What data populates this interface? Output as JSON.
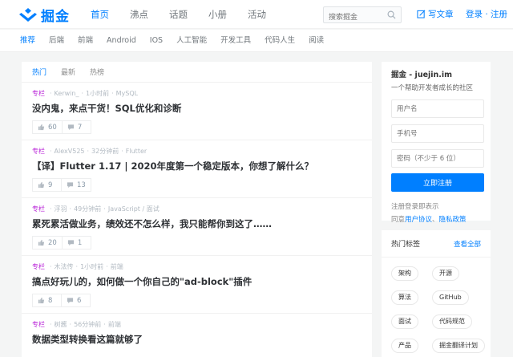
{
  "brand": {
    "name": "掘金",
    "color": "#007fff"
  },
  "nav": [
    "首页",
    "沸点",
    "话题",
    "小册",
    "活动"
  ],
  "search": {
    "placeholder": "搜索掘金"
  },
  "write_label": "写文章",
  "login_label": "登录 · 注册",
  "subnav": [
    "推荐",
    "后端",
    "前端",
    "Android",
    "IOS",
    "人工智能",
    "开发工具",
    "代码人生",
    "阅读"
  ],
  "feed_tabs": [
    "热门",
    "最新",
    "热榜"
  ],
  "entries": [
    {
      "tag": "专栏",
      "author": "Kerwin_",
      "time": "1小时前",
      "category": "MySQL",
      "title": "没内鬼，来点干货！SQL优化和诊断",
      "likes": "60",
      "comments": "7"
    },
    {
      "tag": "专栏",
      "author": "AlexV525",
      "time": "32分钟前",
      "category": "Flutter",
      "title": "【译】Flutter 1.17 | 2020年度第一个稳定版本，你想了解什么？",
      "likes": "9",
      "comments": "13"
    },
    {
      "tag": "专栏",
      "author": "浮羽",
      "time": "49分钟前",
      "category": "JavaScript / 面试",
      "title": "累死累活做业务，绩效还不怎么样，我只能帮你到这了……",
      "likes": "20",
      "comments": "1"
    },
    {
      "tag": "专栏",
      "author": "木法传",
      "time": "1小时前",
      "category": "前端",
      "title": "搞点好玩儿的，如何做一个你自己的\"ad-block\"插件",
      "likes": "8",
      "comments": "6"
    },
    {
      "tag": "专栏",
      "author": "树酱",
      "time": "56分钟前",
      "category": "前端",
      "title": "数据类型转换看这篇就够了",
      "likes": "",
      "comments": ""
    }
  ],
  "register": {
    "title": "掘金 - juejin.im",
    "subtitle": "一个帮助开发者成长的社区",
    "username_placeholder": "用户名",
    "phone_placeholder": "手机号",
    "password_placeholder": "密码（不少于 6 位）",
    "submit_label": "立即注册",
    "note": "注册登录即表示",
    "agree_prefix": "同意",
    "agreement_link": "用户协议",
    "agree_sep": "、",
    "privacy_link": "隐私政策"
  },
  "hot_tags": {
    "title": "热门标签",
    "view_all": "查看全部",
    "tags": [
      "架构",
      "开源",
      "算法",
      "GitHub",
      "面试",
      "代码规范",
      "产品",
      "掘金翻译计划"
    ]
  },
  "colors": {
    "accent": "#007fff",
    "column_tag": "#b71ed7",
    "meta_gray": "#b2bac2"
  }
}
